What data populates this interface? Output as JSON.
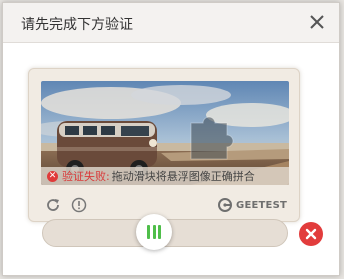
{
  "dialog": {
    "title": "请先完成下方验证"
  },
  "captcha": {
    "fail_title": "验证失败",
    "fail_separator": ":",
    "fail_message": "拖动滑块将悬浮图像正确拼合",
    "brand": "GEETEST"
  },
  "icons": {
    "close": "close-icon",
    "refresh": "refresh-icon",
    "info": "info-icon",
    "brand_logo": "geetest-logo-icon",
    "slider_grip": "grip-icon",
    "error": "error-x-icon"
  },
  "colors": {
    "error": "#e23c3c",
    "grip": "#4fbe4a",
    "widget_bg": "#f1ebe3"
  }
}
